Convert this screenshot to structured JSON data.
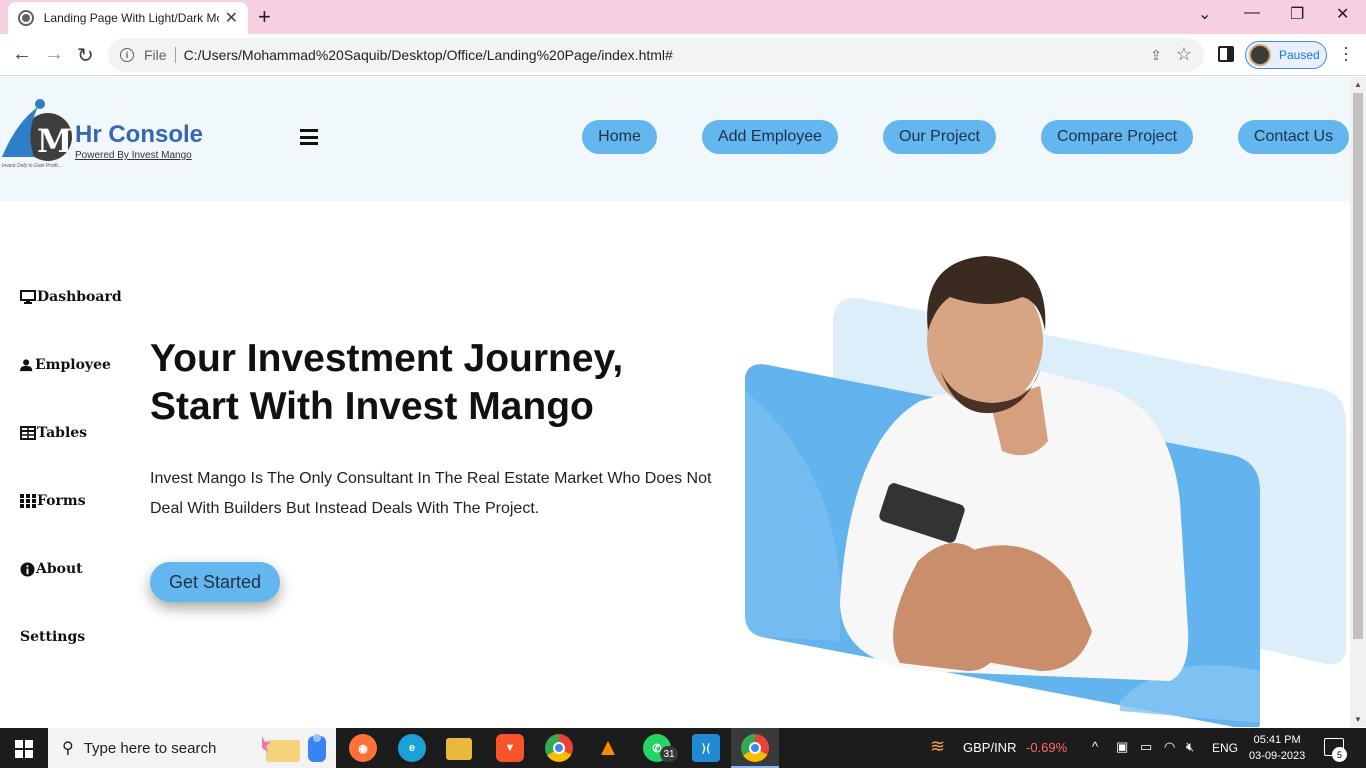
{
  "browser": {
    "tab_title": "Landing Page With Light/Dark Mode",
    "url_scheme_label": "File",
    "url": "C:/Users/Mohammad%20Saquib/Desktop/Office/Landing%20Page/index.html#",
    "profile_status": "Paused"
  },
  "header": {
    "logo_title": "Hr Console",
    "logo_subtitle": "Powered By Invest Mango",
    "logo_tagline": "Invest Only to Gain Profit...",
    "nav": [
      {
        "label": "Home"
      },
      {
        "label": "Add Employee"
      },
      {
        "label": "Our Project"
      },
      {
        "label": "Compare Project"
      },
      {
        "label": "Contact Us"
      }
    ]
  },
  "sidebar": {
    "items": [
      {
        "label": "Dashboard",
        "icon": "desktop-icon"
      },
      {
        "label": "Employee",
        "icon": "user-icon"
      },
      {
        "label": "Tables",
        "icon": "table-icon"
      },
      {
        "label": "Forms",
        "icon": "grid-icon"
      },
      {
        "label": "About",
        "icon": "info-icon"
      },
      {
        "label": "Settings",
        "icon": ""
      }
    ]
  },
  "hero": {
    "title_line1": "Your Investment Journey,",
    "title_line2": "Start With Invest Mango",
    "text_line1": "Invest Mango Is The Only Consultant In The Real Estate Market Who Does Not",
    "text_line2": "Deal With Builders But Instead Deals With The Project.",
    "cta_label": "Get Started"
  },
  "colors": {
    "accent": "#64b6ef",
    "header_bg": "#f1f8fc",
    "logo_blue": "#3667b3"
  },
  "taskbar": {
    "search_placeholder": "Type here to search",
    "whatsapp_badge": "31",
    "fx_pair": "GBP/INR",
    "fx_change": "-0.69%",
    "language": "ENG",
    "time": "05:41 PM",
    "date": "03-09-2023",
    "notification_count": "5"
  }
}
